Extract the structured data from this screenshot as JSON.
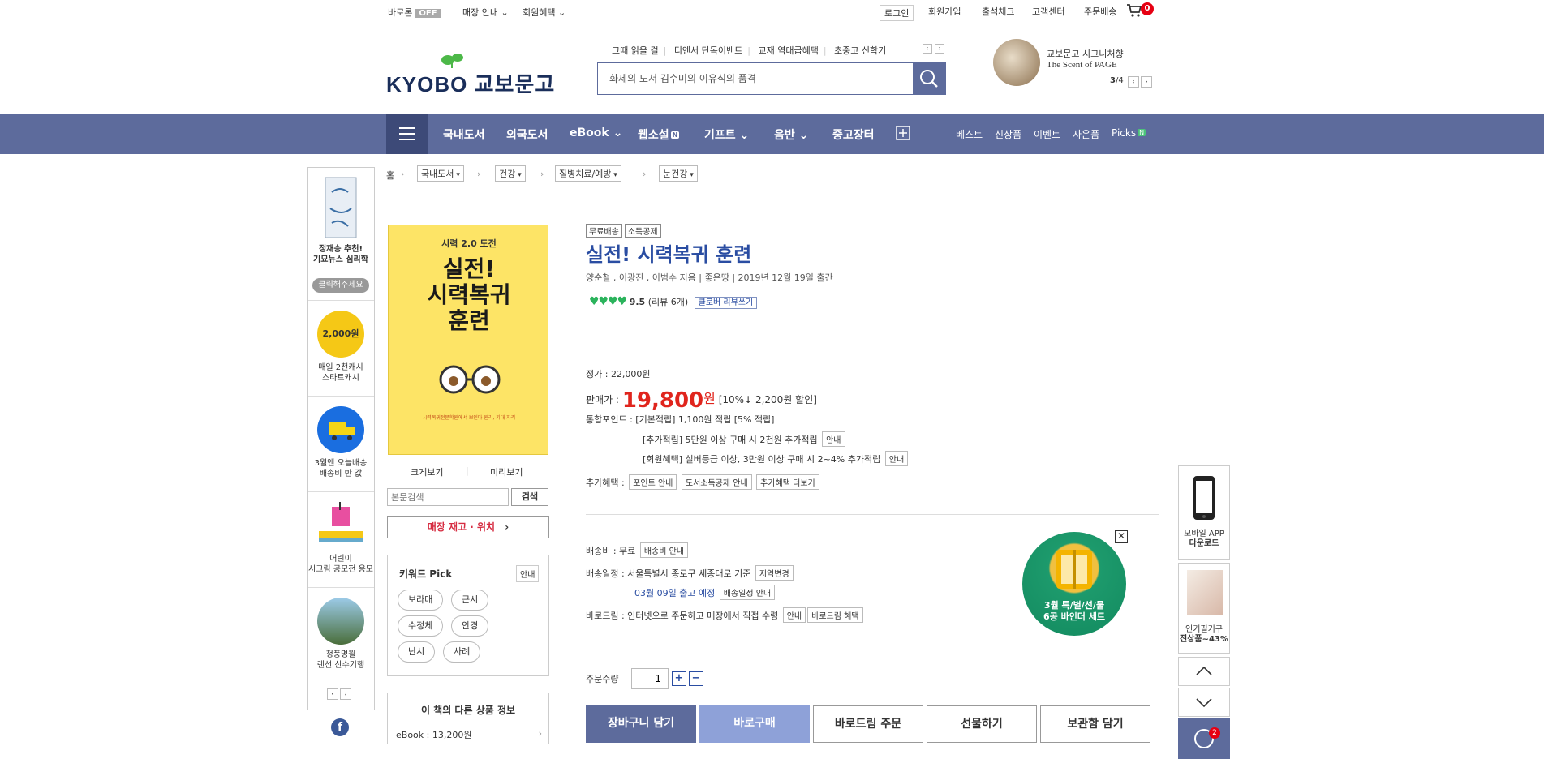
{
  "topbar": {
    "baro": "바로론",
    "baro_state": "OFF",
    "store_info": "매장 안내",
    "member_benefit": "회원혜택",
    "login": "로그인",
    "signup": "회원가입",
    "attendance": "출석체크",
    "customer_center": "고객센터",
    "order_delivery": "주문배송",
    "cart_count": "0"
  },
  "header": {
    "logo_text": "KYOBO 교보문고",
    "links": [
      "그때 읽을 걸",
      "디엔서 단독이벤트",
      "교재 역대급혜택",
      "초중고 신학기"
    ],
    "search_placeholder": "화제의 도서 김수미의 이유식의 품격",
    "promo_line1": "교보문고 시그니처향",
    "promo_line2": "The Scent of PAGE",
    "promo_page_current": "3",
    "promo_page_total": "/4"
  },
  "nav": {
    "items": [
      "국내도서",
      "외국도서",
      "eBook",
      "웹소설",
      "기프트",
      "음반",
      "중고장터"
    ],
    "webnovel_badge": "N",
    "right_items": [
      "베스트",
      "신상품",
      "이벤트",
      "사은품",
      "Picks"
    ],
    "picks_badge": "N"
  },
  "leftbar": {
    "items": [
      {
        "caption1": "정재승 추천!",
        "caption2": "기묘뉴스 심리학",
        "button": "클릭해주세요"
      },
      {
        "caption1": "매일 2천캐시",
        "caption2": "스타트캐시",
        "coin_text": "2,000원"
      },
      {
        "caption1": "3월엔 오늘배송",
        "caption2": "배송비 반 값"
      },
      {
        "caption1": "어린이",
        "caption2": "시그림 공모전 응모"
      },
      {
        "caption1": "청풍명월",
        "caption2": "랜선 산수기행"
      }
    ]
  },
  "breadcrumb": {
    "home": "홈",
    "items": [
      "국내도서",
      "건강",
      "질병치료/예방",
      "눈건강"
    ]
  },
  "cover": {
    "top": "시력 2.0 도전",
    "title_line1": "실전!",
    "title_line2": "시력복귀",
    "title_line3": "훈련",
    "bottom": "시력복귀전문학원에서 보인다 원리, 기대 자격"
  },
  "cover_links": {
    "zoom": "크게보기",
    "preview": "미리보기"
  },
  "content_search": {
    "placeholder": "본문검색",
    "button": "검색"
  },
  "stock_button": "매장 재고 · 위치",
  "keyword": {
    "title": "키워드 Pick",
    "info": "안내",
    "chips": [
      "보라매",
      "근시",
      "수정체",
      "안경",
      "난시",
      "사례"
    ]
  },
  "other_products": {
    "title": "이 책의 다른 상품 정보",
    "ebook": "eBook : 13,200원"
  },
  "product": {
    "tags": [
      "무료배송",
      "소득공제"
    ],
    "title": "실전! 시력복귀 훈련",
    "authors": "양순철 , 이광진 , 이범수 지음 | 좋은땅 | 2019년 12월 19일 출간",
    "rating": "9.5",
    "review_count": "(리뷰 6개)",
    "review_button": "클로버 리뷰쓰기",
    "list_price": "정가 : 22,000원",
    "sale_label": "판매가 :",
    "sale_price": "19,800",
    "sale_unit": "원",
    "discount": "[10%↓ 2,200원 할인]",
    "points_main": "통합포인트 : [기본적립] 1,100원 적립 [5% 적립]",
    "points_extra": "[추가적립] 5만원 이상 구매 시 2천원 추가적립",
    "points_member": "[회원혜택] 실버등급 이상, 3만원 이상 구매 시 2~4% 추가적립",
    "info_button": "안내",
    "benefit_label": "추가혜택 :",
    "benefit_buttons": [
      "포인트 안내",
      "도서소득공제 안내",
      "추가혜택 더보기"
    ],
    "shipping_fee": "배송비 : 무료",
    "shipping_fee_button": "배송비 안내",
    "schedule": "배송일정 : 서울특별시 종로구 세종대로 기준",
    "region_button": "지역변경",
    "release": "03월 09일 출고 예정",
    "release_button": "배송일정 안내",
    "barodrim": "바로드림 : 인터넷으로 주문하고 매장에서 직접 수령",
    "barodrim_info": "안내",
    "barodrim_benefit": "바로드림 혜택",
    "quantity_label": "주문수량",
    "quantity": "1"
  },
  "actions": {
    "cart": "장바구니 담기",
    "buy": "바로구매",
    "barodrim_order": "바로드림 주문",
    "gift": "선물하기",
    "wishlist": "보관함 담기"
  },
  "ad": {
    "line1": "3월 특/별/선/물",
    "line2": "6공 바인더 세트"
  },
  "rightbar": {
    "app_line1": "모바일 APP",
    "app_line2": "다운로드",
    "pen_line1": "인기필기구",
    "pen_line2": "전상품~43%",
    "recent_count": "2"
  },
  "colors": {
    "brand_nav": "#5d6b9c",
    "title_blue": "#2a4da2",
    "price_red": "#e0251d",
    "heart_green": "#2bb35c"
  }
}
